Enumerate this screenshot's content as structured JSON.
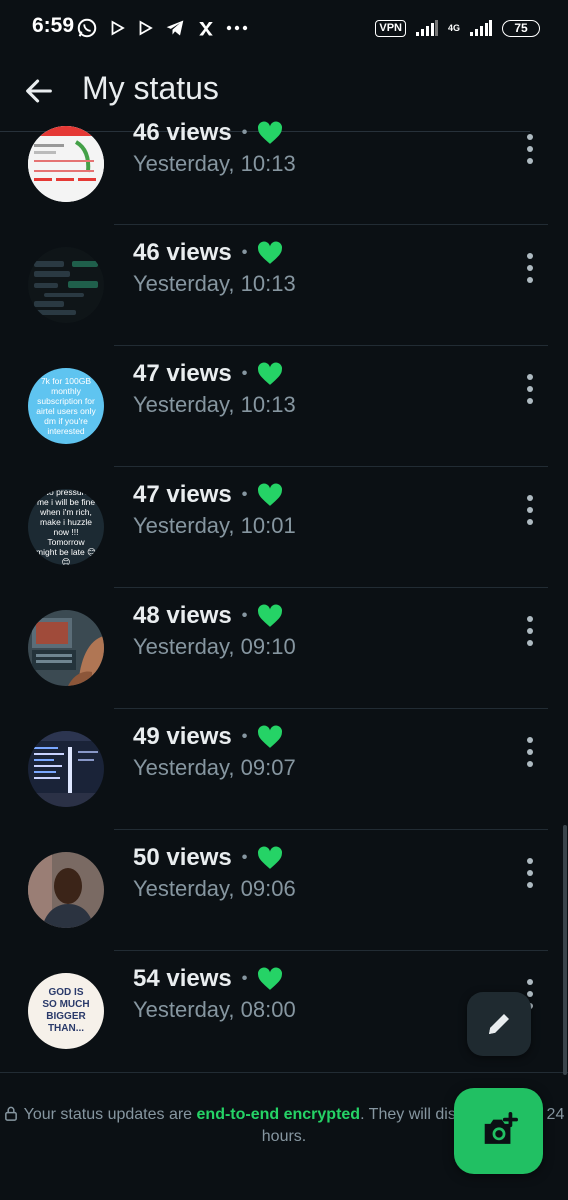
{
  "status_bar": {
    "time": "6:59",
    "vpn": "VPN",
    "network": "4G",
    "battery": "75"
  },
  "toolbar": {
    "title": "My status"
  },
  "statuses": [
    {
      "views": "46 views",
      "time": "Yesterday, 10:13",
      "thumb": "airtel-screenshot"
    },
    {
      "views": "46 views",
      "time": "Yesterday, 10:13",
      "thumb": "chat-screenshot"
    },
    {
      "views": "47 views",
      "time": "Yesterday, 10:13",
      "thumb": "text-blue",
      "text": "7k for 100GB monthly subscription for airtel users only dm if you're interested"
    },
    {
      "views": "47 views",
      "time": "Yesterday, 10:01",
      "thumb": "text-dark",
      "text": "No pressure me i will be fine when i'm rich, make i huzzle now !!! Tomorrow might be late 😊😊"
    },
    {
      "views": "48 views",
      "time": "Yesterday, 09:10",
      "thumb": "photo-laptop"
    },
    {
      "views": "49 views",
      "time": "Yesterday, 09:07",
      "thumb": "photo-code"
    },
    {
      "views": "50 views",
      "time": "Yesterday, 09:06",
      "thumb": "photo-person"
    },
    {
      "views": "54 views",
      "time": "Yesterday, 08:00",
      "thumb": "image-quote",
      "text": "GOD IS SO MUCH BIGGER THAN..."
    }
  ],
  "footer": {
    "text_before": "Your status updates are ",
    "encrypted": "end-to-end encrypted",
    "text_after": ". They will disappear after 24 hours."
  },
  "colors": {
    "accent": "#25d366",
    "background": "#0b1014",
    "fab": "#21c063"
  }
}
